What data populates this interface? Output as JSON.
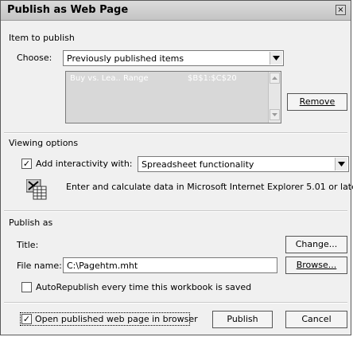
{
  "window": {
    "title": "Publish as Web Page",
    "close_glyph": "×"
  },
  "item_section": {
    "label": "Item to publish",
    "choose_label": "Choose:",
    "choose_value": "Previously published items",
    "list": [
      {
        "name": "Buy vs. Lea.. Range",
        "range": "$B$1:$C$20"
      }
    ],
    "remove_button": "Remove"
  },
  "viewing_section": {
    "label": "Viewing options",
    "interactivity_checked": true,
    "interactivity_label": "Add interactivity with:",
    "interactivity_value": "Spreadsheet functionality",
    "info_text": "Enter and calculate data in Microsoft Internet Explorer 5.01 or later."
  },
  "publish_section": {
    "label": "Publish as",
    "title_label": "Title:",
    "change_button": "Change...",
    "filename_label": "File name:",
    "filename_value": "C:\\Pagehtm.mht",
    "browse_button": "Browse...",
    "autorepublish_checked": false,
    "autorepublish_label": "AutoRepublish every time this workbook is saved",
    "open_in_browser_checked": true,
    "open_in_browser_label": "Open published web page in browser"
  },
  "footer": {
    "publish_button": "Publish",
    "cancel_button": "Cancel"
  },
  "icons": {
    "dropdown": "chevron-down-icon",
    "spreadsheet": "spreadsheet-icon",
    "check": "check-icon"
  },
  "colors": {
    "list_selected_bg": "#d8d8d8",
    "dialog_bg": "#f0f0f0"
  }
}
